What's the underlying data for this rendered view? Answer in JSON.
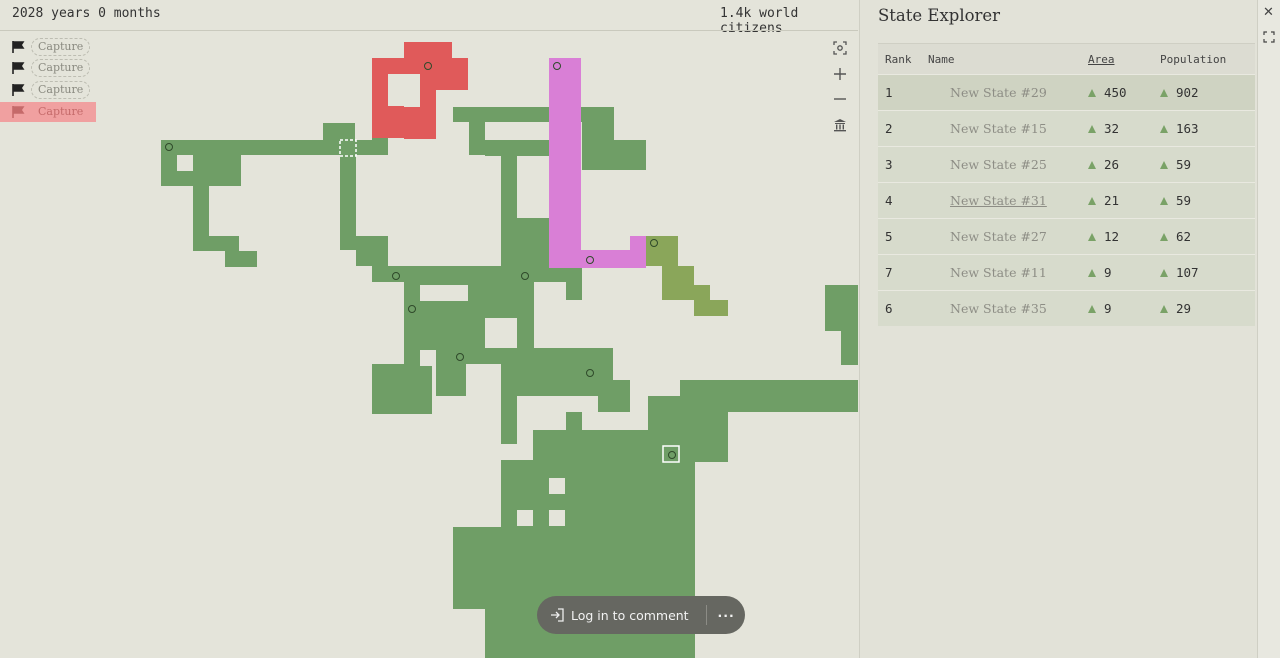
{
  "topbar": {
    "time_label": "2028 years 0 months",
    "citizens_label": "1.4k world citizens"
  },
  "capture": {
    "items": [
      {
        "label": "Capture",
        "active": false
      },
      {
        "label": "Capture",
        "active": false
      },
      {
        "label": "Capture",
        "active": false
      },
      {
        "label": "Capture",
        "active": true
      }
    ]
  },
  "map_tools": [
    "focus-icon",
    "zoom-in-icon",
    "zoom-out-icon",
    "landmark-icon"
  ],
  "comment_bar": {
    "login_label": "Log in to comment",
    "more_label": "···"
  },
  "panel": {
    "title": "State Explorer",
    "columns": {
      "rank": "Rank",
      "name": "Name",
      "area": "Area",
      "population": "Population"
    },
    "rows": [
      {
        "rank": "1",
        "name": "New State #29",
        "area": "450",
        "population": "902"
      },
      {
        "rank": "2",
        "name": "New State #15",
        "area": "32",
        "population": "163"
      },
      {
        "rank": "3",
        "name": "New State #25",
        "area": "26",
        "population": "59"
      },
      {
        "rank": "4",
        "name": "New State #31",
        "area": "21",
        "population": "59"
      },
      {
        "rank": "5",
        "name": "New State #27",
        "area": "12",
        "population": "62"
      },
      {
        "rank": "7",
        "name": "New State #11",
        "area": "9",
        "population": "107"
      },
      {
        "rank": "6",
        "name": "New State #35",
        "area": "9",
        "population": "29"
      }
    ]
  },
  "colors": {
    "background": "#e4e4da",
    "state_green": "#6f9e66",
    "state_red": "#e05a5a",
    "state_pink": "#d97fd6",
    "state_olive": "#8aa65a",
    "trend_up": "#7aa267"
  }
}
